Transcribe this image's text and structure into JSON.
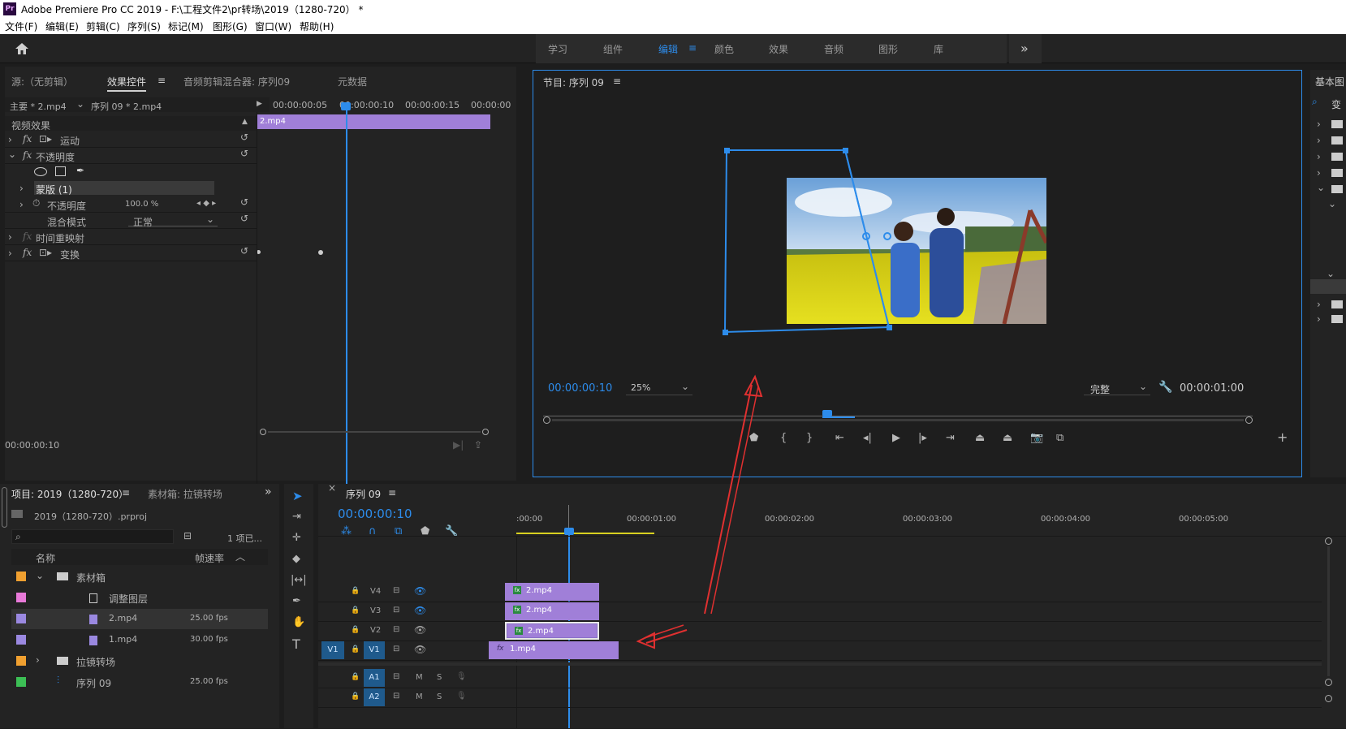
{
  "window": {
    "title": "Adobe Premiere Pro CC 2019 - F:\\工程文件2\\pr转场\\2019（1280-720） *"
  },
  "menu": [
    "文件(F)",
    "编辑(E)",
    "剪辑(C)",
    "序列(S)",
    "标记(M)",
    "图形(G)",
    "窗口(W)",
    "帮助(H)"
  ],
  "workspaces": [
    "学习",
    "组件",
    "编辑",
    "颜色",
    "效果",
    "音频",
    "图形",
    "库"
  ],
  "active_workspace": "编辑",
  "more": "»",
  "source_panel": {
    "tabs": [
      "源:（无剪辑）",
      "效果控件",
      "音频剪辑混合器: 序列09",
      "元数据"
    ],
    "active": "效果控件",
    "menu": "≡"
  },
  "effect_controls": {
    "master": "主要 * 2.mp4",
    "sequence": "序列 09 * 2.mp4",
    "ruler": [
      "00:00:00:05",
      "00:00:00:10",
      "00:00:00:15",
      "00:00:00"
    ],
    "clip_name": "2.mp4",
    "section": "视频效果",
    "motion": "运动",
    "opacity": "不透明度",
    "mask": "蒙版 (1)",
    "opacity_param": "不透明度",
    "opacity_value": "100.0 %",
    "blend_label": "混合模式",
    "blend_value": "正常",
    "time_remap": "时间重映射",
    "transform": "变换",
    "timecode": "00:00:00:10"
  },
  "program": {
    "title": "节目: 序列 09",
    "menu": "≡",
    "timecode": "00:00:00:10",
    "zoom": "25%",
    "quality": "完整",
    "duration": "00:00:01:00"
  },
  "essential": {
    "title": "基本图",
    "search_label": "变"
  },
  "project": {
    "tabs": [
      "项目: 2019（1280-720）",
      "素材箱: 拉镜转场"
    ],
    "file": "2019（1280-720）.prproj",
    "count": "1 项已...",
    "col_name": "名称",
    "col_fps": "帧速率",
    "items": [
      {
        "name": "素材箱",
        "fps": "",
        "color": "#f0a030",
        "indent": 0,
        "type": "folder",
        "open": true
      },
      {
        "name": "调整图层",
        "fps": "",
        "color": "#e879d8",
        "indent": 1,
        "type": "adj"
      },
      {
        "name": "2.mp4",
        "fps": "25.00 fps",
        "color": "#9a88e0",
        "indent": 1,
        "type": "clip"
      },
      {
        "name": "1.mp4",
        "fps": "30.00 fps",
        "color": "#9a88e0",
        "indent": 1,
        "type": "clip"
      },
      {
        "name": "拉镜转场",
        "fps": "",
        "color": "#f0a030",
        "indent": 0,
        "type": "folder",
        "open": false
      },
      {
        "name": "序列 09",
        "fps": "25.00 fps",
        "color": "#3cbf55",
        "indent": 0,
        "type": "seq"
      }
    ]
  },
  "timeline": {
    "title": "序列 09",
    "menu": "≡",
    "timecode": "00:00:00:10",
    "ruler": [
      ":00:00",
      "00:00:01:00",
      "00:00:02:00",
      "00:00:03:00",
      "00:00:04:00",
      "00:00:05:00"
    ],
    "tracks": [
      {
        "name": "V4",
        "clip": "2.mp4"
      },
      {
        "name": "V3",
        "clip": "2.mp4"
      },
      {
        "name": "V2",
        "clip": "2.mp4"
      },
      {
        "name": "V1",
        "clip": "1.mp4",
        "src": "V1"
      },
      {
        "name": "A1",
        "clip": ""
      },
      {
        "name": "A2",
        "clip": ""
      }
    ],
    "fx": "fx",
    "m": "M",
    "s": "S"
  },
  "colors": {
    "accent": "#2d8ceb",
    "clip": "#a07fd8",
    "arrow": "#e03030"
  }
}
